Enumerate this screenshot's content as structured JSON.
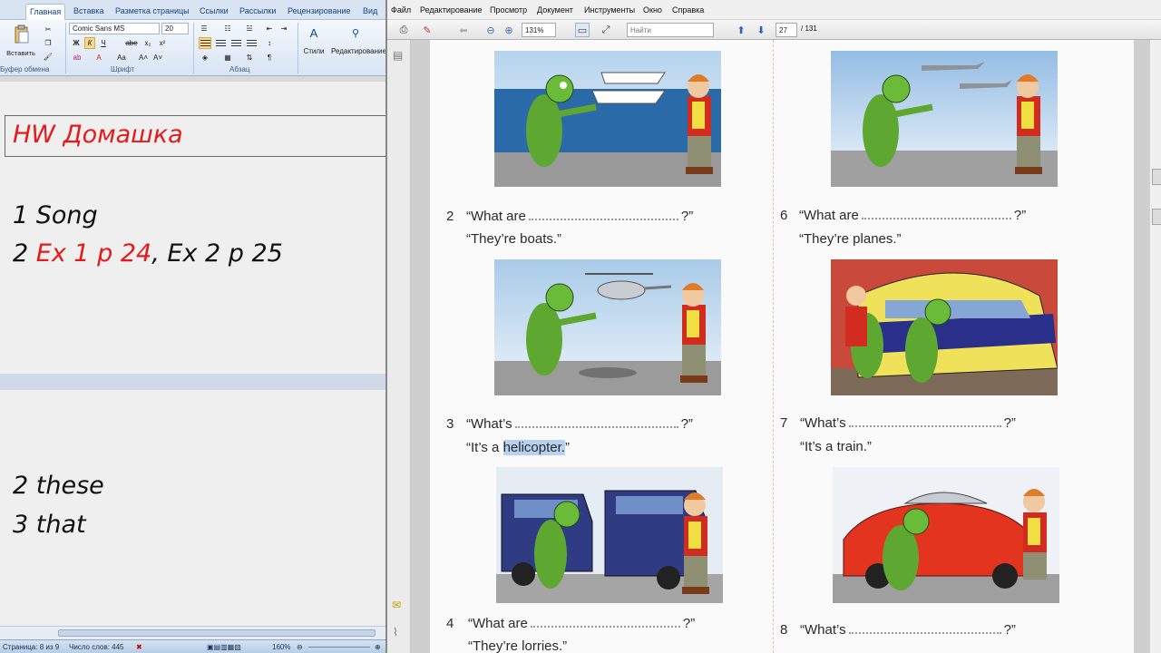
{
  "word": {
    "tabs": [
      "Главная",
      "Вставка",
      "Разметка страницы",
      "Ссылки",
      "Рассылки",
      "Рецензирование",
      "Вид"
    ],
    "font_name": "Comic Sans MS",
    "font_size": "20",
    "paste_label": "Вставить",
    "group_labels": [
      "Буфер обмена",
      "Шрифт",
      "Абзац",
      "Стили",
      "Редактирование"
    ],
    "styles_label": "Стили",
    "editing_label": "Редактирование",
    "doc": {
      "hw_title": "HW Домашка",
      "line1": "1 Song",
      "line2_num": "2 ",
      "line2_red": "Ex 1 p 24",
      "line2_rest": ", Ex 2 p 25",
      "line3": "2 these",
      "line4": "3 that"
    },
    "status": {
      "page": "Страница: 8 из 9",
      "words": "Число слов: 445",
      "zoom": "160%"
    }
  },
  "reader": {
    "menu": [
      "Файл",
      "Редактирование",
      "Просмотр",
      "Документ",
      "Инструменты",
      "Окно",
      "Справка"
    ],
    "zoom": "131%",
    "find_placeholder": "Найти",
    "page_current": "27",
    "page_total": "/ 131",
    "exercises": {
      "e2_num": "2",
      "e2_q": "“What are",
      "e2_end": "?”",
      "e2_a": "“They’re boats.”",
      "e3_num": "3",
      "e3_q": "“What’s",
      "e3_end": "?”",
      "e3_a_pre": "“It’s a ",
      "e3_a_hl": "helicopter.",
      "e3_a_post": "”",
      "e4_num": "4",
      "e4_q": "“What are",
      "e4_end": "?”",
      "e4_a": "“They’re lorries.”",
      "e6_num": "6",
      "e6_q": "“What are",
      "e6_end": "?”",
      "e6_a": "“They’re planes.”",
      "e7_num": "7",
      "e7_q": "“What’s",
      "e7_end": "?”",
      "e7_a": "“It’s a train.”",
      "e8_num": "8",
      "e8_q": "“What’s",
      "e8_end": "?”"
    }
  }
}
